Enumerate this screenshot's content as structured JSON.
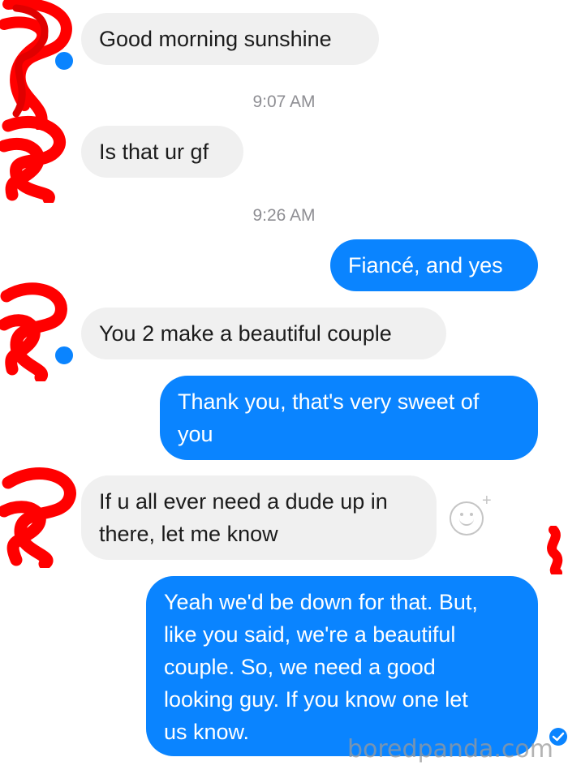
{
  "conversation": {
    "messages": [
      {
        "type": "incoming",
        "text": "Good morning sunshine"
      },
      {
        "type": "timestamp",
        "text": "9:07 AM"
      },
      {
        "type": "incoming",
        "text": "Is that ur gf"
      },
      {
        "type": "timestamp",
        "text": "9:26 AM"
      },
      {
        "type": "outgoing",
        "text": "Fiancé, and yes"
      },
      {
        "type": "incoming",
        "text": "You 2 make a beautiful couple"
      },
      {
        "type": "outgoing",
        "text": "Thank you, that's very sweet of\nyou"
      },
      {
        "type": "incoming",
        "text": "If u all ever need a dude up in\nthere, let me know"
      },
      {
        "type": "outgoing",
        "text": "Yeah we'd be down for that. But,\nlike you said, we're a beautiful\ncouple. So, we need a good\nlooking guy. If you know one let\nus know."
      }
    ]
  },
  "icons": {
    "reaction_button": "smiley-add-icon",
    "messenger_badge": "messenger-badge-icon",
    "read_receipt": "read-check-icon"
  },
  "colors": {
    "outgoing_bubble": "#0a84ff",
    "incoming_bubble": "#f0f0f0",
    "redaction": "#ff0000"
  },
  "watermark": "boredpanda.com"
}
